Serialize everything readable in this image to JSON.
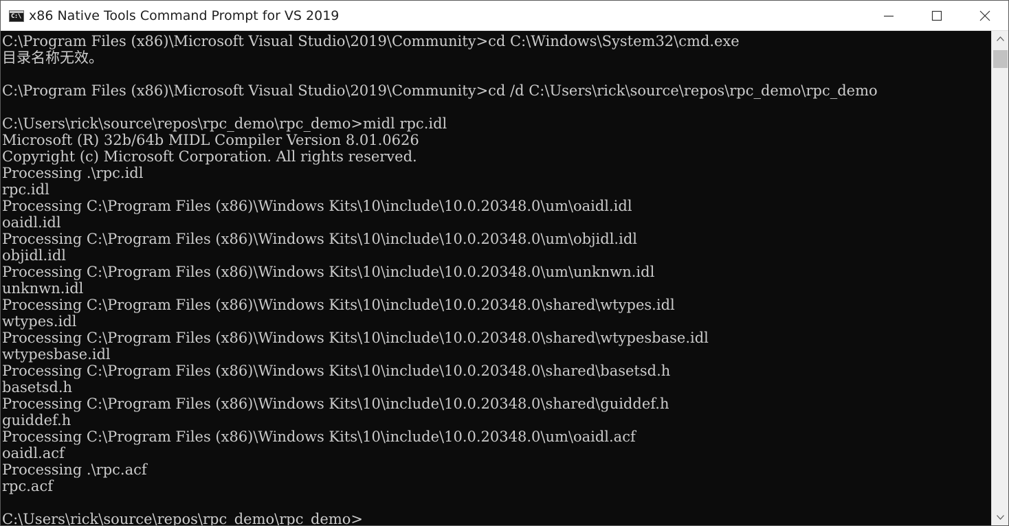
{
  "window": {
    "title": "x86 Native Tools Command Prompt for VS 2019",
    "icon": "cmd-icon",
    "controls": {
      "minimize": "minimize-icon",
      "maximize": "maximize-icon",
      "close": "close-icon"
    }
  },
  "console": {
    "text_color": "#cccccc",
    "background": "#0c0c0c",
    "lines": [
      "C:\\Program Files (x86)\\Microsoft Visual Studio\\2019\\Community>cd C:\\Windows\\System32\\cmd.exe",
      "目录名称无效。",
      "",
      "C:\\Program Files (x86)\\Microsoft Visual Studio\\2019\\Community>cd /d C:\\Users\\rick\\source\\repos\\rpc_demo\\rpc_demo",
      "",
      "C:\\Users\\rick\\source\\repos\\rpc_demo\\rpc_demo>midl rpc.idl",
      "Microsoft (R) 32b/64b MIDL Compiler Version 8.01.0626",
      "Copyright (c) Microsoft Corporation. All rights reserved.",
      "Processing .\\rpc.idl",
      "rpc.idl",
      "Processing C:\\Program Files (x86)\\Windows Kits\\10\\include\\10.0.20348.0\\um\\oaidl.idl",
      "oaidl.idl",
      "Processing C:\\Program Files (x86)\\Windows Kits\\10\\include\\10.0.20348.0\\um\\objidl.idl",
      "objidl.idl",
      "Processing C:\\Program Files (x86)\\Windows Kits\\10\\include\\10.0.20348.0\\um\\unknwn.idl",
      "unknwn.idl",
      "Processing C:\\Program Files (x86)\\Windows Kits\\10\\include\\10.0.20348.0\\shared\\wtypes.idl",
      "wtypes.idl",
      "Processing C:\\Program Files (x86)\\Windows Kits\\10\\include\\10.0.20348.0\\shared\\wtypesbase.idl",
      "wtypesbase.idl",
      "Processing C:\\Program Files (x86)\\Windows Kits\\10\\include\\10.0.20348.0\\shared\\basetsd.h",
      "basetsd.h",
      "Processing C:\\Program Files (x86)\\Windows Kits\\10\\include\\10.0.20348.0\\shared\\guiddef.h",
      "guiddef.h",
      "Processing C:\\Program Files (x86)\\Windows Kits\\10\\include\\10.0.20348.0\\um\\oaidl.acf",
      "oaidl.acf",
      "Processing .\\rpc.acf",
      "rpc.acf",
      "",
      "C:\\Users\\rick\\source\\repos\\rpc_demo\\rpc_demo>"
    ]
  },
  "scrollbar": {
    "up_icon": "scroll-up-arrow-icon",
    "down_icon": "scroll-down-arrow-icon"
  }
}
